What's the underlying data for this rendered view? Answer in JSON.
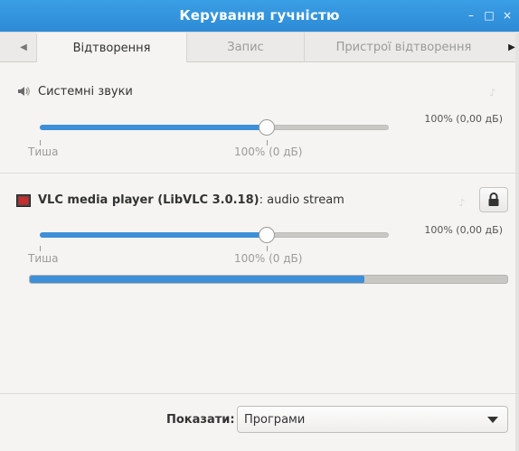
{
  "window": {
    "title": "Керування гучністю",
    "controls": {
      "minimize": "–",
      "maximize": "□",
      "close": "×"
    }
  },
  "tabs": [
    {
      "label": "Відтворення",
      "active": true
    },
    {
      "label": "Запис",
      "active": false
    },
    {
      "label": "Пристрої відтворення",
      "active": false
    }
  ],
  "system_sounds": {
    "label": "Системні звуки",
    "icon": "speaker-icon",
    "volume_text": "100% (0,00 дБ)",
    "volume_fraction": 0.65,
    "scale_min_label": "Тиша",
    "scale_mid_label": "100% (0 дБ)"
  },
  "vlc_stream": {
    "app_name": "VLC media player (LibVLC 3.0.18)",
    "stream_suffix": ": audio stream",
    "icon": "vlc-icon",
    "volume_text": "100% (0,00 дБ)",
    "volume_fraction": 0.65,
    "scale_min_label": "Тиша",
    "scale_mid_label": "100% (0 дБ)",
    "level_fraction": 0.7,
    "lock_icon": "lock-icon"
  },
  "footer": {
    "show_label": "Показати:",
    "show_value": "Програми"
  },
  "colors": {
    "titlebar": "#3a9fe4",
    "accent": "#3d8fd8"
  }
}
